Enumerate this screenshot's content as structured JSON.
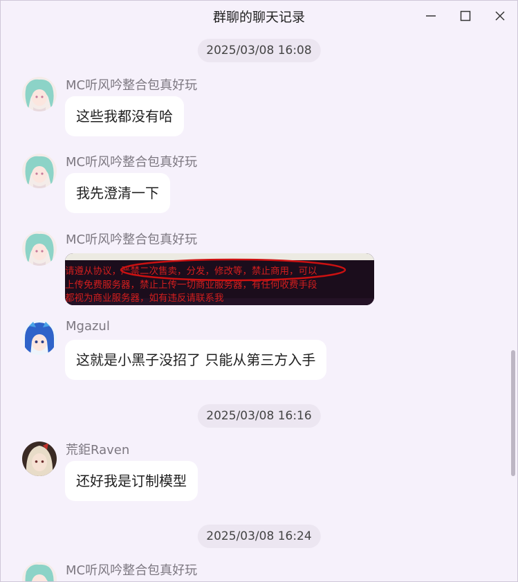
{
  "window": {
    "title": "群聊的聊天记录",
    "controls": {
      "minimize": "—",
      "maximize": "☐",
      "close": "✕"
    }
  },
  "timestamps": [
    "2025/03/08 16:08",
    "2025/03/08 16:16",
    "2025/03/08 16:24"
  ],
  "messages": [
    {
      "sender": "MC听风吟整合包真好玩",
      "text": "这些我都没有哈"
    },
    {
      "sender": "MC听风吟整合包真好玩",
      "text": "我先澄清一下"
    },
    {
      "sender": "MC听风吟整合包真好玩",
      "image_lines": [
        "请遵从协议，严禁二次售卖，分发，修改等，禁止商用，可以",
        "上传免费服务器，禁止上传一切商业服务器，有任何收费手段",
        "都视为商业服务器，如有违反请联系我"
      ]
    },
    {
      "sender": "Mgazul",
      "text": "这就是小黑子没招了 只能从第三方入手"
    },
    {
      "sender": "荒鉅Raven",
      "text": "还好我是订制模型"
    },
    {
      "sender": "MC听风吟整合包真好玩"
    }
  ],
  "colors": {
    "background": "#f6f1fb",
    "bubble": "#ffffff",
    "timestamp_pill": "#ece6f1",
    "image_text": "#d21e1e",
    "ellipse": "#cc1111"
  }
}
